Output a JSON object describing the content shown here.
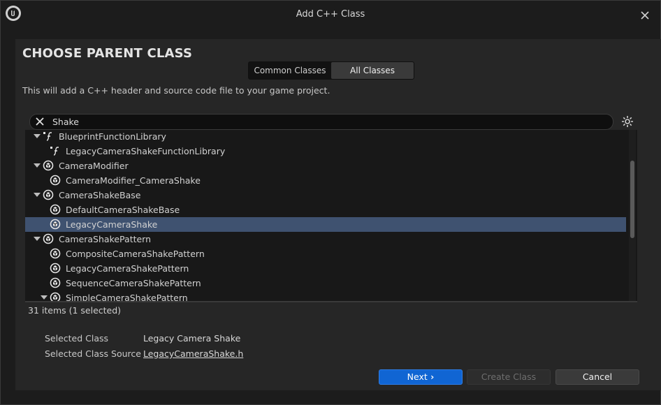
{
  "window": {
    "title": "Add C++ Class"
  },
  "heading": "CHOOSE PARENT CLASS",
  "toggle": {
    "options": [
      "Common Classes",
      "All Classes"
    ],
    "selected": "All Classes"
  },
  "description": "This will add a C++ header and source code file to your game project.",
  "search": {
    "value": "Shake",
    "placeholder": ""
  },
  "tree": [
    {
      "label": "BlueprintFunctionLibrary",
      "depth": 0,
      "expanded": true,
      "icon": "function-library-icon"
    },
    {
      "label": "LegacyCameraShakeFunctionLibrary",
      "depth": 1,
      "icon": "function-library-icon"
    },
    {
      "label": "CameraModifier",
      "depth": 0,
      "expanded": true,
      "icon": "class-icon"
    },
    {
      "label": "CameraModifier_CameraShake",
      "depth": 1,
      "icon": "class-icon"
    },
    {
      "label": "CameraShakeBase",
      "depth": 0,
      "expanded": true,
      "icon": "class-icon"
    },
    {
      "label": "DefaultCameraShakeBase",
      "depth": 1,
      "icon": "class-icon"
    },
    {
      "label": "LegacyCameraShake",
      "depth": 1,
      "icon": "class-icon",
      "selected": true
    },
    {
      "label": "CameraShakePattern",
      "depth": 0,
      "expanded": true,
      "icon": "class-icon"
    },
    {
      "label": "CompositeCameraShakePattern",
      "depth": 1,
      "icon": "class-icon"
    },
    {
      "label": "LegacyCameraShakePattern",
      "depth": 1,
      "icon": "class-icon"
    },
    {
      "label": "SequenceCameraShakePattern",
      "depth": 1,
      "icon": "class-icon"
    },
    {
      "label": "SimpleCameraShakePattern",
      "depth": 1,
      "expanded": true,
      "icon": "class-icon"
    }
  ],
  "status": {
    "count": "31 items (1 selected)"
  },
  "selection": {
    "class_label": "Selected Class",
    "class_value": "Legacy Camera Shake",
    "source_label": "Selected Class Source",
    "source_value": "LegacyCameraShake.h"
  },
  "buttons": {
    "next": "Next",
    "create": "Create Class",
    "cancel": "Cancel"
  },
  "colors": {
    "accent": "#1065d3",
    "selected_row": "#3f5270",
    "background": "#1c1c1c"
  }
}
